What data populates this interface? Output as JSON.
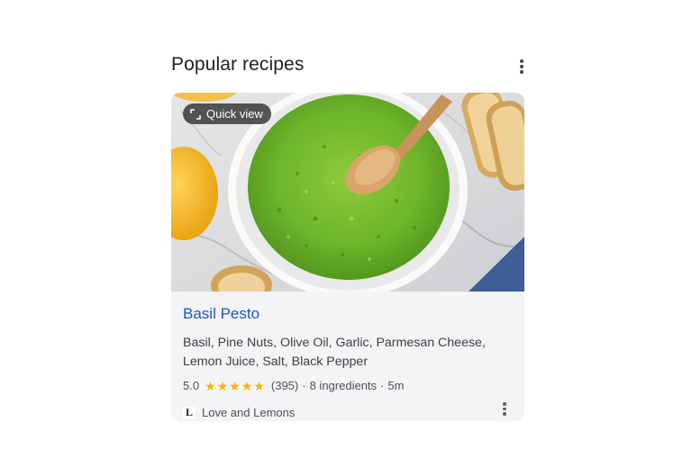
{
  "section": {
    "title": "Popular recipes",
    "more_icon": "more-vert-icon"
  },
  "card": {
    "quick_view_label": "Quick view",
    "quick_view_icon": "expand-icon",
    "title": "Basil Pesto",
    "ingredients": "Basil, Pine Nuts, Olive Oil, Garlic, Parmesan Cheese, Lemon Juice, Salt, Black Pepper",
    "rating": "5.0",
    "stars": 5,
    "reviews": "(395)",
    "ingredient_count": "8 ingredients",
    "time": "5m",
    "separator": "·",
    "source": "Love and Lemons",
    "source_logo": "L",
    "more_icon": "more-vert-icon"
  },
  "colors": {
    "title_link": "#1a56c4",
    "star": "#f4b400",
    "card_bg": "#f3f4f6"
  }
}
